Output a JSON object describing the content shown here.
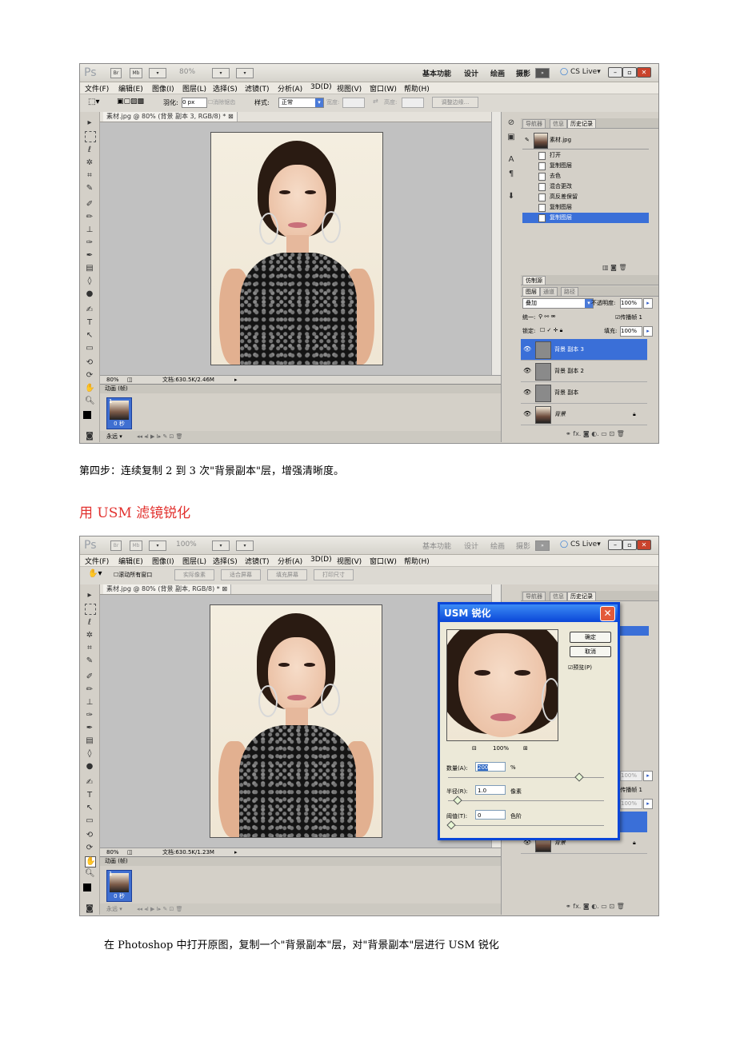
{
  "screenshot1": {
    "app_logo": "Ps",
    "top_buttons": [
      "Br",
      "Mb"
    ],
    "zoom_display": "80%",
    "workspaces": [
      "基本功能",
      "设计",
      "绘画",
      "摄影"
    ],
    "cs_live": "CS Live",
    "menu": [
      "文件(F)",
      "编辑(E)",
      "图像(I)",
      "图层(L)",
      "选择(S)",
      "滤镜(T)",
      "分析(A)",
      "3D(D)",
      "视图(V)",
      "窗口(W)",
      "帮助(H)"
    ],
    "options": {
      "feather_label": "羽化:",
      "feather_value": "0 px",
      "antialias": "消除锯齿",
      "style_label": "样式:",
      "style_value": "正常",
      "width_label": "宽度:",
      "height_label": "高度:",
      "refine_edge": "调整边缘..."
    },
    "doc_tab": "素材.jpg @ 80% (背景 副本 3, RGB/8) * ⊠",
    "status_zoom": "80%",
    "status_doc": "文档:630.5K/2.46M",
    "anim_header": "动画 (帧)",
    "frame_number": "1",
    "frame_time": "0 秒",
    "loop": "永远",
    "panel_tabs": [
      "导航器",
      "信息",
      "历史记录"
    ],
    "history_source": "素材.jpg",
    "history": [
      "打开",
      "复制图层",
      "去色",
      "混合更改",
      "高反差保留",
      "复制图层",
      "复制图层"
    ],
    "clone_tab": "仿制源",
    "layer_tabs": [
      "图层",
      "通道",
      "路径"
    ],
    "blend_mode": "叠加",
    "opacity_label": "不透明度:",
    "opacity_value": "100%",
    "unify_label": "统一:",
    "propagate": "传播帧 1",
    "lock_label": "锁定:",
    "fill_label": "填充:",
    "fill_value": "100%",
    "layers": [
      "背景 副本 3",
      "背景 副本 2",
      "背景 副本",
      "背景"
    ]
  },
  "caption1": "第四步：连续复制 2 到 3 次\"背景副本\"层，增强清晰度。",
  "heading": "用 USM 滤镜锐化",
  "screenshot2": {
    "app_logo": "Ps",
    "zoom_display": "100%",
    "workspaces": [
      "基本功能",
      "设计",
      "绘画",
      "摄影"
    ],
    "cs_live": "CS Live",
    "menu": [
      "文件(F)",
      "编辑(E)",
      "图像(I)",
      "图层(L)",
      "选择(S)",
      "滤镜(T)",
      "分析(A)",
      "3D(D)",
      "视图(V)",
      "窗口(W)",
      "帮助(H)"
    ],
    "options": {
      "scroll_all": "滚动所有窗口",
      "actual_pixels": "实际像素",
      "fit_screen": "适合屏幕",
      "fill_screen": "填充屏幕",
      "print_size": "打印尺寸"
    },
    "doc_tab": "素材.jpg @ 80% (背景 副本, RGB/8) * ⊠",
    "status_zoom": "80%",
    "status_doc": "文档:630.5K/1.23M",
    "anim_header": "动画 (帧)",
    "frame_number": "1",
    "frame_time": "0 秒",
    "loop": "永远",
    "panel_tabs": [
      "导航器",
      "信息",
      "历史记录"
    ],
    "opacity_value": "100%",
    "propagate": "传播帧 1",
    "fill_value": "100%",
    "bottom_layer": "背景",
    "dialog": {
      "title": "USM 锐化",
      "ok": "确定",
      "cancel": "取消",
      "preview": "预览(P)",
      "zoom": "100%",
      "amount_label": "数量(A):",
      "amount_value": "200",
      "amount_unit": "%",
      "radius_label": "半径(R):",
      "radius_value": "1.0",
      "radius_unit": "像素",
      "threshold_label": "阈值(T):",
      "threshold_value": "0",
      "threshold_unit": "色阶"
    }
  },
  "caption2": "在 Photoshop 中打开原图，复制一个\"背景副本\"层，对\"背景副本\"层进行 USM 锐化"
}
